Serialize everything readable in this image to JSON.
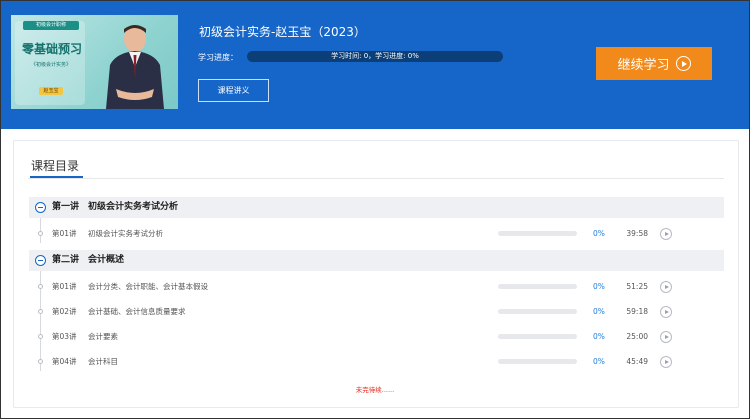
{
  "header": {
    "thumbnail": {
      "top_badge": "初级会计职称",
      "main_text": "零基础预习",
      "sub_text": "《初级会计实务》",
      "name_badge": "赵玉宝"
    },
    "course_title": "初级会计实务-赵玉宝（2023）",
    "progress_label": "学习进度：",
    "progress_text": "学习时间: 0，学习进度: 0%",
    "progress_value": 0,
    "notes_button": "课程讲义",
    "continue_button": "继续学习"
  },
  "catalog": {
    "title": "课程目录",
    "chapters": [
      {
        "title": "第一讲　初级会计实务考试分析",
        "lessons": [
          {
            "num": "第01讲",
            "title": "初级会计实务考试分析",
            "progress": "0%",
            "progress_value": 0,
            "duration": "39:58"
          }
        ]
      },
      {
        "title": "第二讲　会计概述",
        "lessons": [
          {
            "num": "第01讲",
            "title": "会计分类、会计职能、会计基本假设",
            "progress": "0%",
            "progress_value": 0,
            "duration": "51:25"
          },
          {
            "num": "第02讲",
            "title": "会计基础、会计信息质量要求",
            "progress": "0%",
            "progress_value": 0,
            "duration": "59:18"
          },
          {
            "num": "第03讲",
            "title": "会计要素",
            "progress": "0%",
            "progress_value": 0,
            "duration": "25:00"
          },
          {
            "num": "第04讲",
            "title": "会计科目",
            "progress": "0%",
            "progress_value": 0,
            "duration": "45:49"
          }
        ]
      }
    ],
    "footer_note": "未完待续......"
  },
  "colors": {
    "header_bg": "#1666c9",
    "continue_button": "#f28a1b",
    "accent": "#1666c9",
    "footer_note": "#e0261b"
  }
}
